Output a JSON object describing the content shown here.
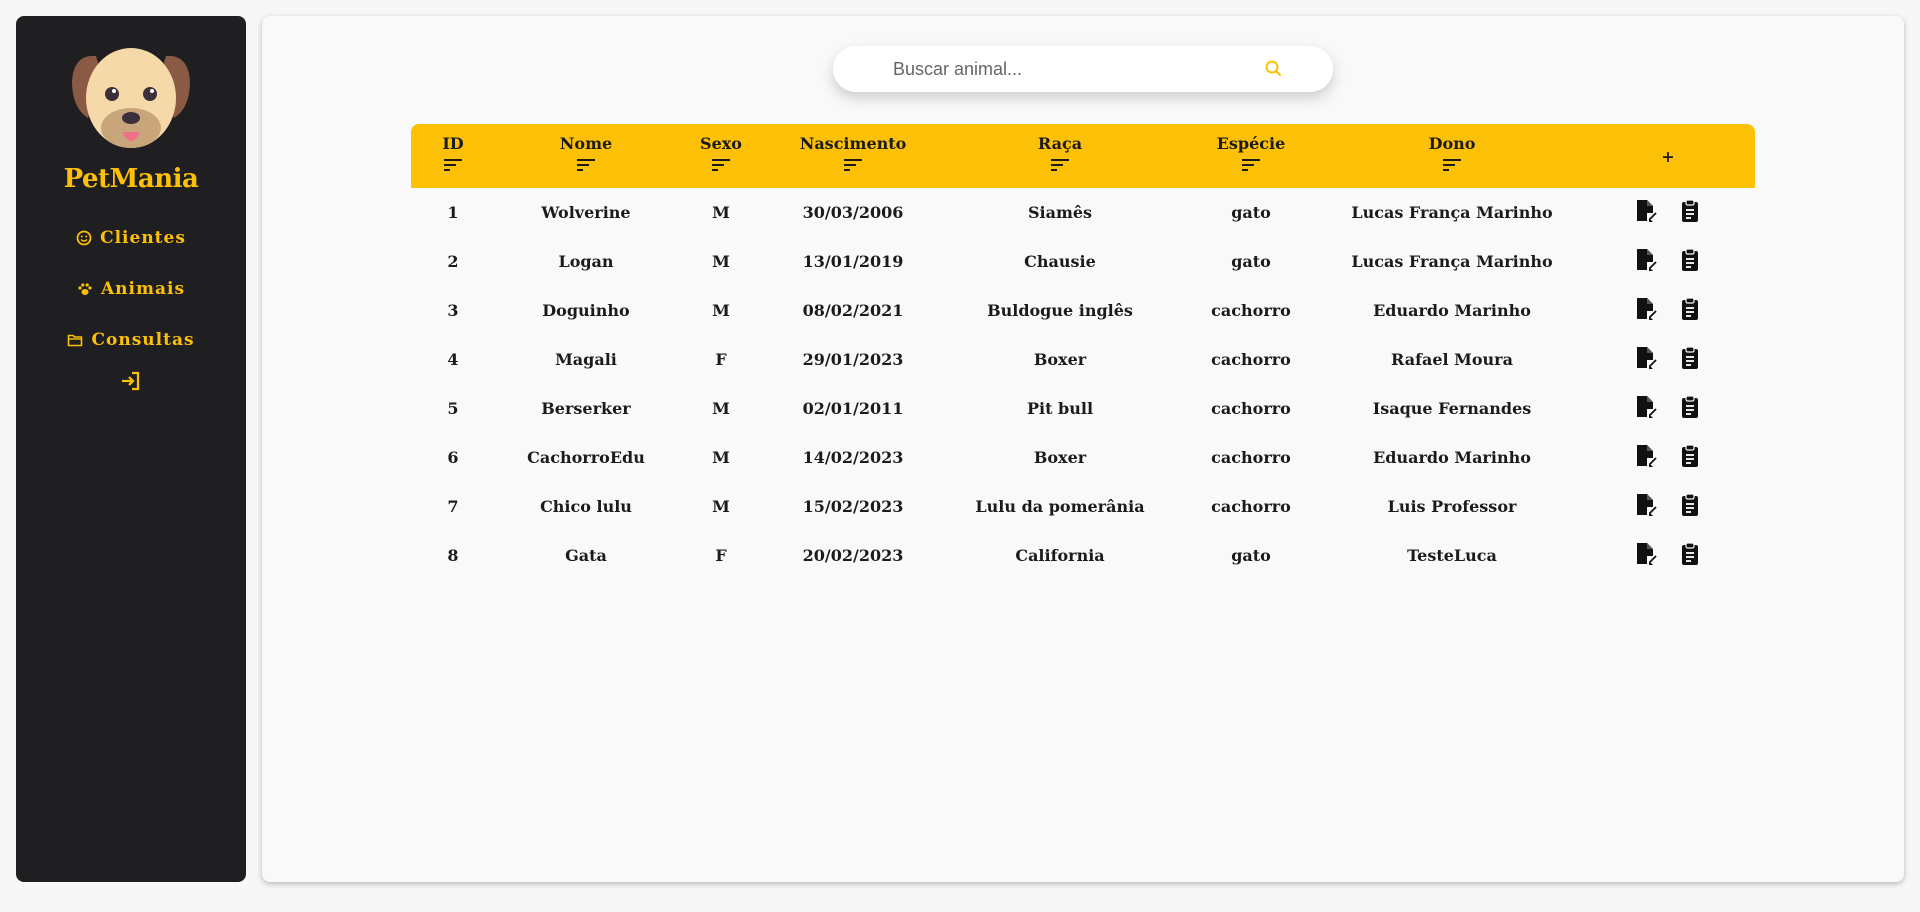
{
  "brand": {
    "name": "PetMania"
  },
  "nav": {
    "items": [
      {
        "label": "Clientes",
        "icon": "smile-icon"
      },
      {
        "label": "Animais",
        "icon": "paw-icon"
      },
      {
        "label": "Consultas",
        "icon": "folder-icon"
      }
    ],
    "logout_icon": "login-arrow-icon"
  },
  "search": {
    "placeholder": "Buscar animal...",
    "icon": "search-icon"
  },
  "colors": {
    "accent": "#fcc007",
    "sidebar_bg": "#1f1e20",
    "main_bg": "#f9f9f9"
  },
  "table": {
    "headers": [
      "ID",
      "Nome",
      "Sexo",
      "Nascimento",
      "Raça",
      "Espécie",
      "Dono"
    ],
    "add_label": "+",
    "rows": [
      [
        "1",
        "Wolverine",
        "M",
        "30/03/2006",
        "Siamês",
        "gato",
        "Lucas França Marinho"
      ],
      [
        "2",
        "Logan",
        "M",
        "13/01/2019",
        "Chausie",
        "gato",
        "Lucas França Marinho"
      ],
      [
        "3",
        "Doguinho",
        "M",
        "08/02/2021",
        "Buldogue inglês",
        "cachorro",
        "Eduardo Marinho"
      ],
      [
        "4",
        "Magali",
        "F",
        "29/01/2023",
        "Boxer",
        "cachorro",
        "Rafael Moura"
      ],
      [
        "5",
        "Berserker",
        "M",
        "02/01/2011",
        "Pit bull",
        "cachorro",
        "Isaque Fernandes"
      ],
      [
        "6",
        "CachorroEdu",
        "M",
        "14/02/2023",
        "Boxer",
        "cachorro",
        "Eduardo Marinho"
      ],
      [
        "7",
        "Chico lulu",
        "M",
        "15/02/2023",
        "Lulu da pomerânia",
        "cachorro",
        "Luis Professor"
      ],
      [
        "8",
        "Gata",
        "F",
        "20/02/2023",
        "California",
        "gato",
        "TesteLuca"
      ]
    ]
  }
}
